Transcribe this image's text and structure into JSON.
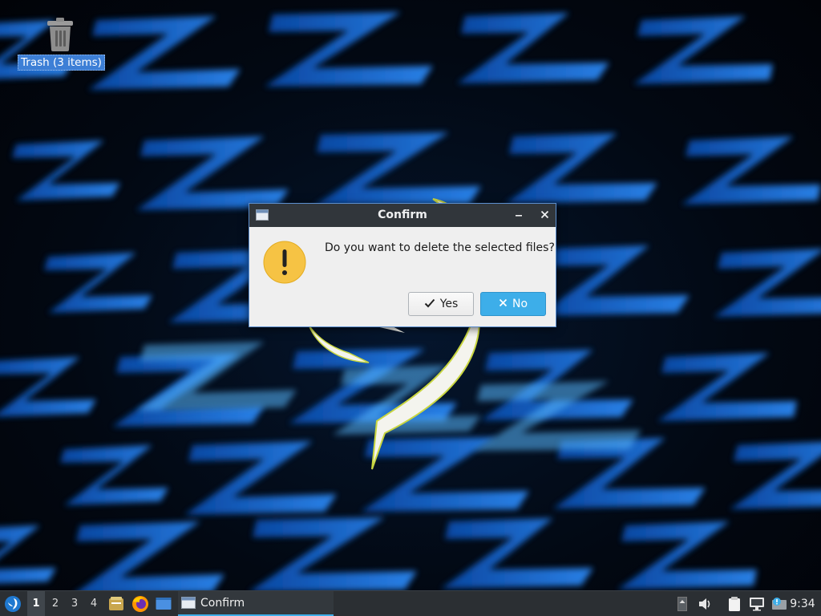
{
  "desktop": {
    "icons": [
      {
        "name": "trash",
        "label": "Trash (3 items)",
        "icon": "trash-icon"
      }
    ]
  },
  "dialog": {
    "title": "Confirm",
    "message": "Do you want to delete the selected files?",
    "icon": "warning-icon",
    "buttons": {
      "yes_label": "Yes",
      "no_label": "No"
    },
    "titlebar_buttons": [
      "minimize",
      "close"
    ],
    "accent_color": "#3daee9"
  },
  "taskbar": {
    "start_menu_icon": "lubuntu-logo-icon",
    "workspaces": [
      "1",
      "2",
      "3",
      "4"
    ],
    "active_workspace": "1",
    "launchers": [
      "file-manager-icon",
      "firefox-icon",
      "show-desktop-icon"
    ],
    "tasks": [
      {
        "label": "Confirm",
        "active": true
      }
    ],
    "tray": [
      "volume-icon",
      "clipboard-icon",
      "network-icon",
      "update-notifier-icon"
    ],
    "clock": "9:34"
  }
}
